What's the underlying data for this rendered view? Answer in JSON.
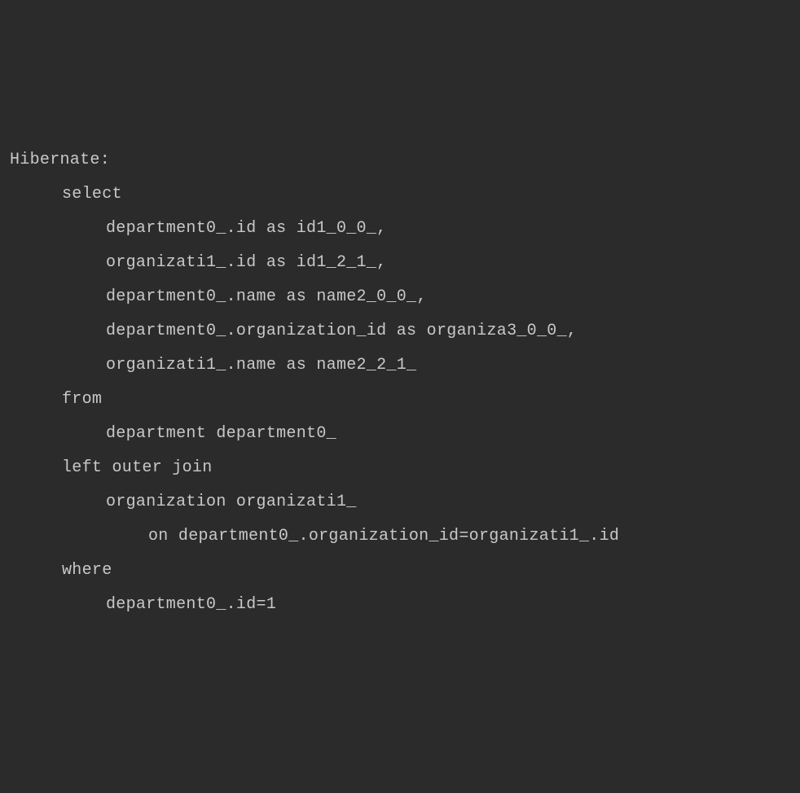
{
  "lines": [
    {
      "indent": 0,
      "text": "Hibernate:"
    },
    {
      "indent": 1,
      "text": "select"
    },
    {
      "indent": 2,
      "text": "department0_.id as id1_0_0_,"
    },
    {
      "indent": 2,
      "text": "organizati1_.id as id1_2_1_,"
    },
    {
      "indent": 2,
      "text": "department0_.name as name2_0_0_,"
    },
    {
      "indent": 2,
      "text": "department0_.organization_id as organiza3_0_0_,"
    },
    {
      "indent": 2,
      "text": "organizati1_.name as name2_2_1_"
    },
    {
      "indent": 1,
      "text": "from"
    },
    {
      "indent": 2,
      "text": "department department0_"
    },
    {
      "indent": 1,
      "text": "left outer join"
    },
    {
      "indent": 2,
      "text": "organization organizati1_"
    },
    {
      "indent": 3,
      "text": "on department0_.organization_id=organizati1_.id"
    },
    {
      "indent": 1,
      "text": "where"
    },
    {
      "indent": 2,
      "text": "department0_.id=1"
    }
  ]
}
